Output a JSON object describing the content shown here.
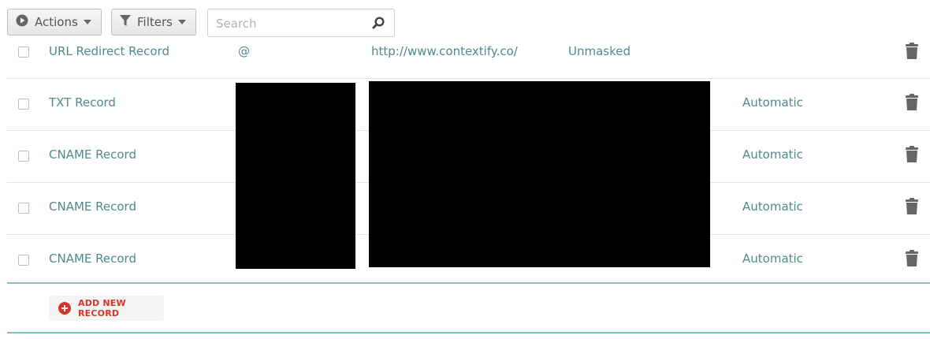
{
  "toolbar": {
    "actions_label": "Actions",
    "filters_label": "Filters",
    "search_placeholder": "Search"
  },
  "records": [
    {
      "type": "URL Redirect Record",
      "host": "@",
      "value": "http://www.contextify.co/",
      "ttl": "Unmasked"
    },
    {
      "type": "TXT Record",
      "host": "",
      "value": "",
      "ttl": "Automatic"
    },
    {
      "type": "CNAME Record",
      "host": "",
      "value": "",
      "ttl": "Automatic"
    },
    {
      "type": "CNAME Record",
      "host": "",
      "value": "",
      "ttl": "Automatic"
    },
    {
      "type": "CNAME Record",
      "host": "",
      "value": "",
      "ttl": "Automatic"
    }
  ],
  "footer": {
    "add_record_label": "ADD NEW RECORD"
  },
  "colors": {
    "accent_teal": "#4f8a89",
    "divider_teal": "#7cc1c2",
    "add_red": "#d6342b"
  }
}
